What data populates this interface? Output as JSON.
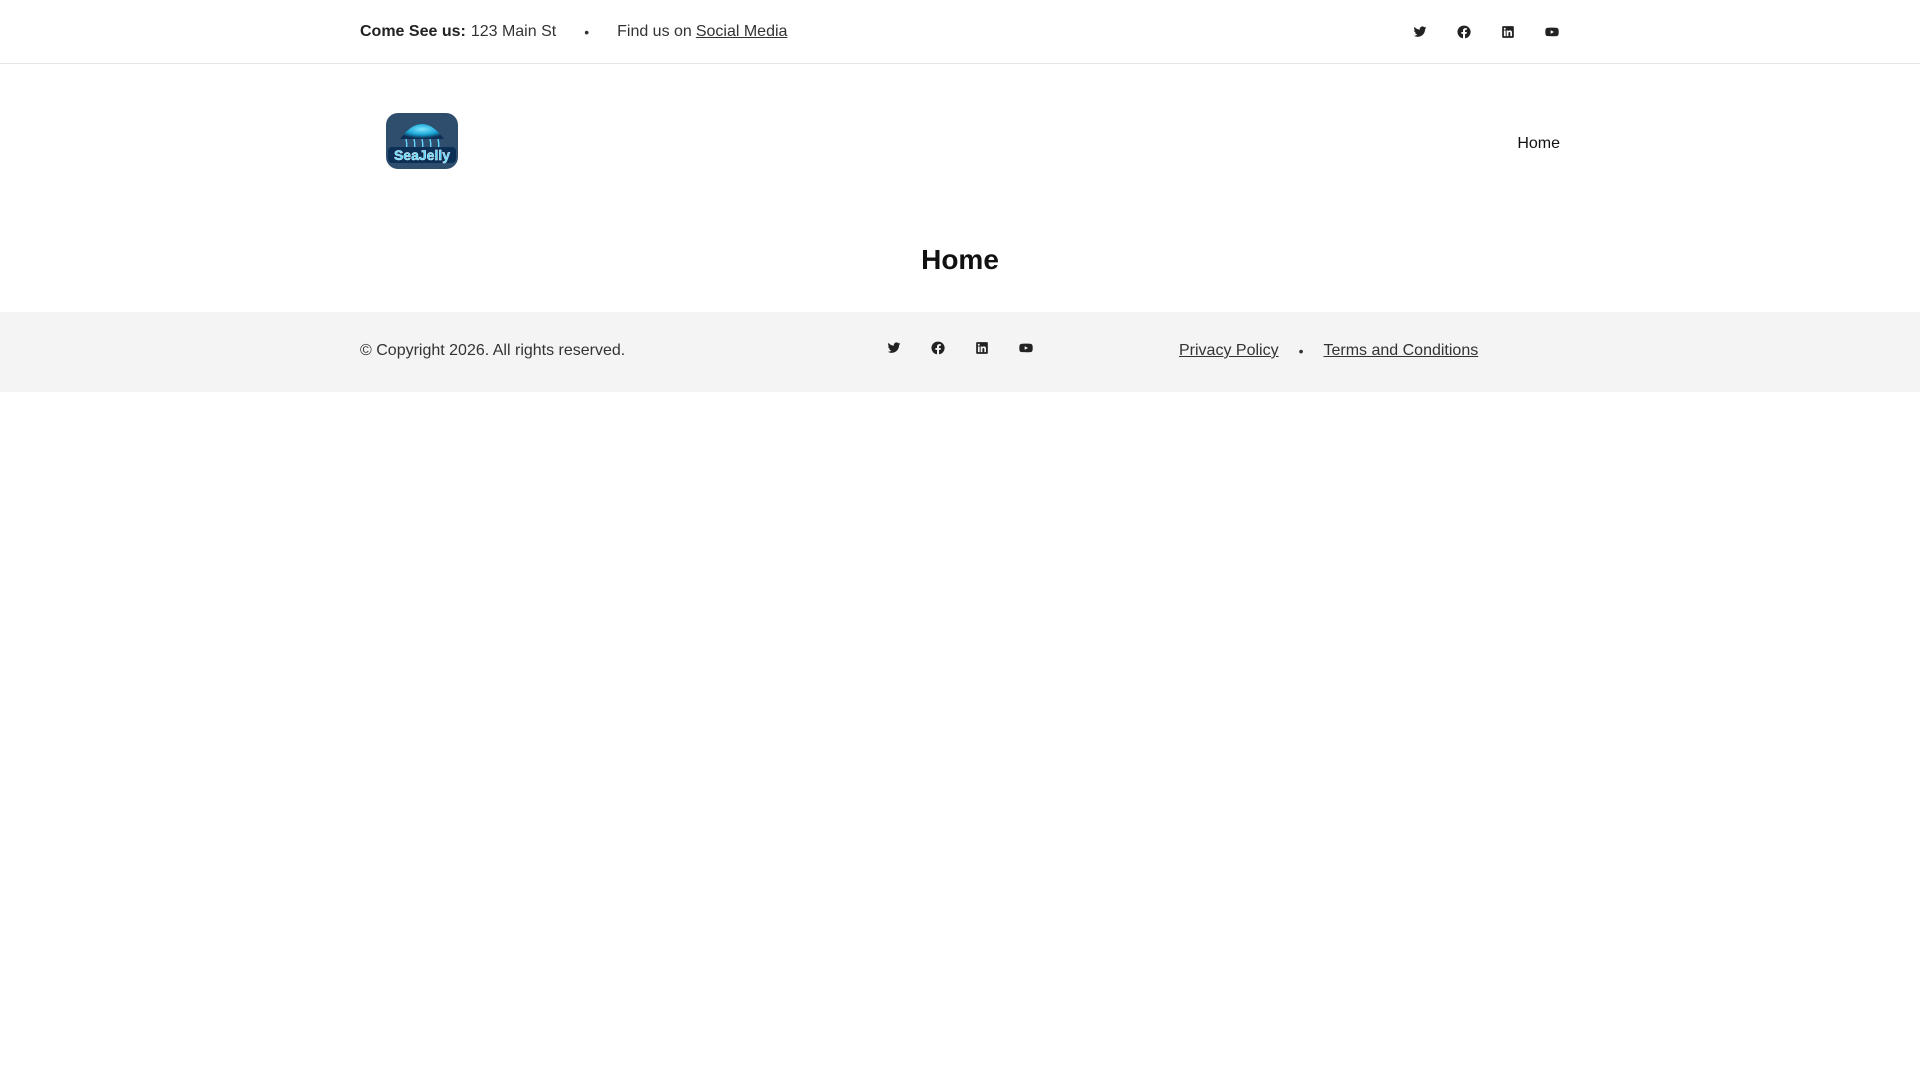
{
  "topbar": {
    "address_label": "Come See us:",
    "address_value": "123 Main St",
    "separator": "•",
    "find_text": "Find us on",
    "social_link": "Social Media",
    "social_icons": [
      "twitter-icon",
      "facebook-icon",
      "linkedin-icon",
      "youtube-icon"
    ]
  },
  "header": {
    "logo_text": "SeaJelly",
    "nav": [
      {
        "label": "Home"
      }
    ]
  },
  "main": {
    "title": "Home"
  },
  "footer": {
    "copyright": "© Copyright 2026. All rights reserved.",
    "social_icons": [
      "twitter-icon",
      "facebook-icon",
      "linkedin-icon",
      "youtube-icon"
    ],
    "links": [
      {
        "label": "Privacy Policy"
      },
      {
        "label": "Terms and Conditions"
      }
    ],
    "separator": "•"
  },
  "colors": {
    "text": "#222222",
    "footer_bg": "#f4f4f4",
    "border": "#e6e6e6",
    "logo_primary": "#1aa6d6",
    "logo_dark": "#0b2f55"
  }
}
